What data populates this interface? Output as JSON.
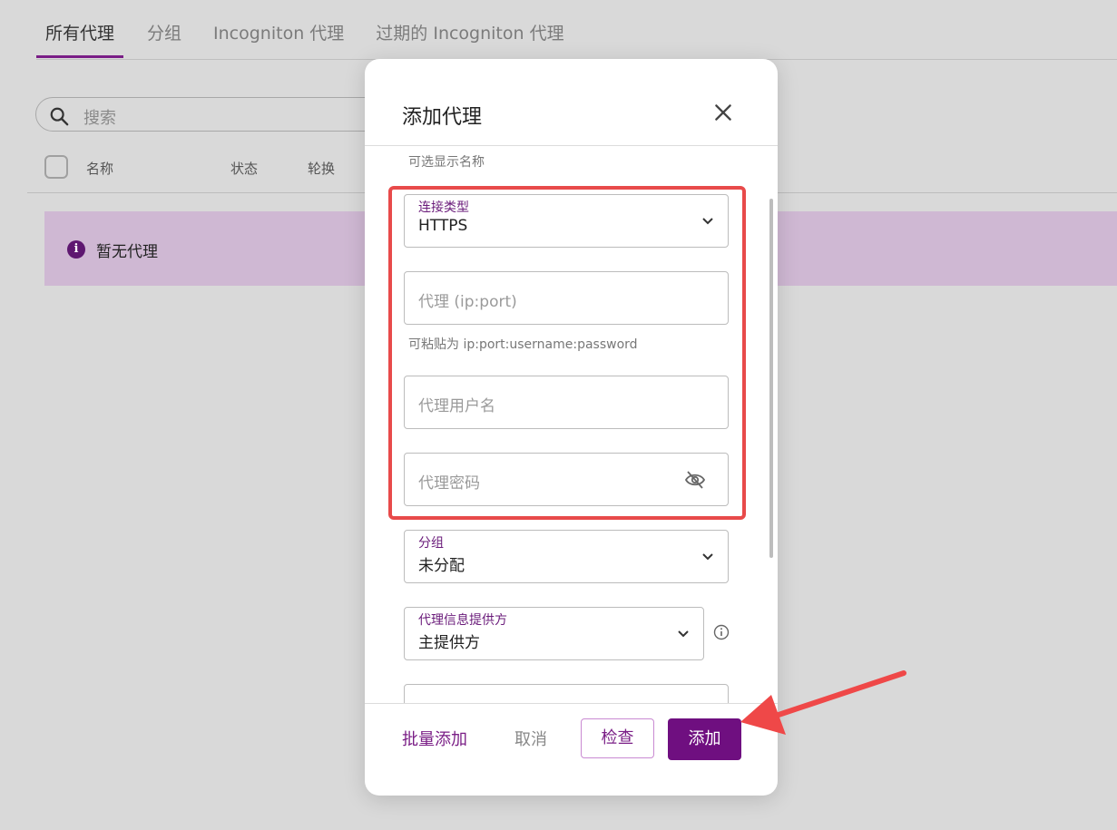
{
  "tabs": [
    "所有代理",
    "分组",
    "Incogniton 代理",
    "过期的 Incogniton 代理"
  ],
  "search": {
    "placeholder": "搜索"
  },
  "table": {
    "columns": [
      "名称",
      "状态",
      "轮换"
    ]
  },
  "empty_state": {
    "text": "暂无代理"
  },
  "modal": {
    "title": "添加代理",
    "display_name_hint": "可选显示名称",
    "connection_type": {
      "label": "连接类型",
      "value": "HTTPS"
    },
    "proxy": {
      "placeholder": "代理 (ip:port)",
      "hint": "可粘贴为 ip:port:username:password"
    },
    "username": {
      "placeholder": "代理用户名"
    },
    "password": {
      "placeholder": "代理密码"
    },
    "group": {
      "label": "分组",
      "value": "未分配"
    },
    "provider": {
      "label": "代理信息提供方",
      "value": "主提供方"
    },
    "footer": {
      "bulk_add": "批量添加",
      "cancel": "取消",
      "check": "检查",
      "add": "添加"
    }
  },
  "colors": {
    "accent": "#6f0f80",
    "highlight": "#e84a4a",
    "empty_bg": "#cfb8d3"
  },
  "icons": [
    "search-icon",
    "info-icon",
    "close-icon",
    "chevron-down-icon",
    "eye-off-icon",
    "info-outline-icon",
    "arrow-annotation"
  ]
}
